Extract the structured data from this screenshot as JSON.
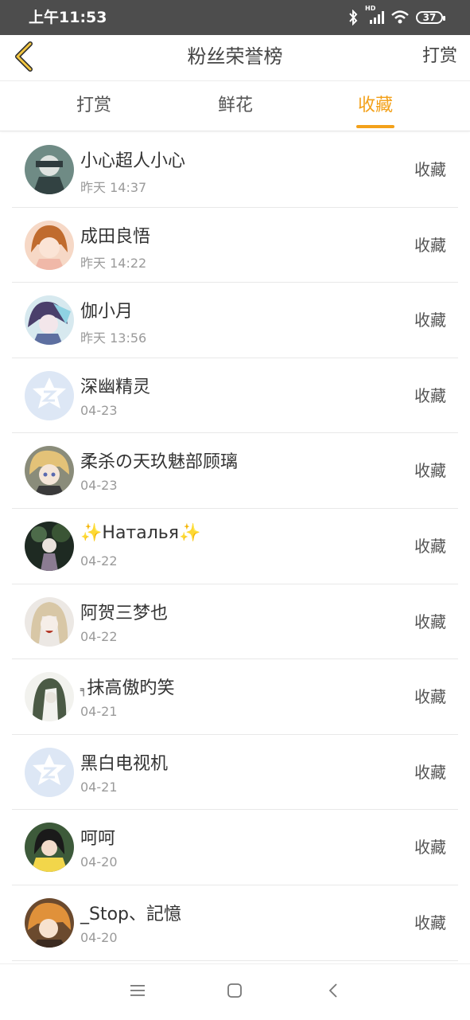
{
  "status_bar": {
    "time": "上午11:53",
    "hd_label": "HD",
    "battery": "37"
  },
  "header": {
    "back_icon": "chevron-left-icon",
    "title": "粉丝荣誉榜",
    "action": "打赏"
  },
  "tabs": [
    {
      "label": "打赏",
      "active": false
    },
    {
      "label": "鲜花",
      "active": false
    },
    {
      "label": "收藏",
      "active": true
    }
  ],
  "accent_color": "#f3a11a",
  "rows": [
    {
      "name": "小心超人小心",
      "date": "昨天 14:37",
      "action": "收藏"
    },
    {
      "name": "成田良悟",
      "date": "昨天 14:22",
      "action": "收藏"
    },
    {
      "name": "伽小月",
      "date": "昨天 13:56",
      "action": "收藏"
    },
    {
      "name": "深幽精灵",
      "date": "04-23",
      "action": "收藏"
    },
    {
      "name": "柔杀の天玖魅部顾璃",
      "date": "04-23",
      "action": "收藏"
    },
    {
      "name": "Наталья",
      "date": "04-22",
      "action": "收藏"
    },
    {
      "name": "阿贺三梦也",
      "date": "04-22",
      "action": "收藏"
    },
    {
      "name": "抹高傲旳笑",
      "date": "04-21",
      "action": "收藏"
    },
    {
      "name": "黑白电视机",
      "date": "04-21",
      "action": "收藏"
    },
    {
      "name": "呵呵",
      "date": "04-20",
      "action": "收藏"
    },
    {
      "name": "_Stop、記憶",
      "date": "04-20",
      "action": "收藏"
    }
  ],
  "nav": {
    "menu_icon": "menu-icon",
    "home_icon": "home-square-icon",
    "back_icon": "back-chevron-icon"
  }
}
